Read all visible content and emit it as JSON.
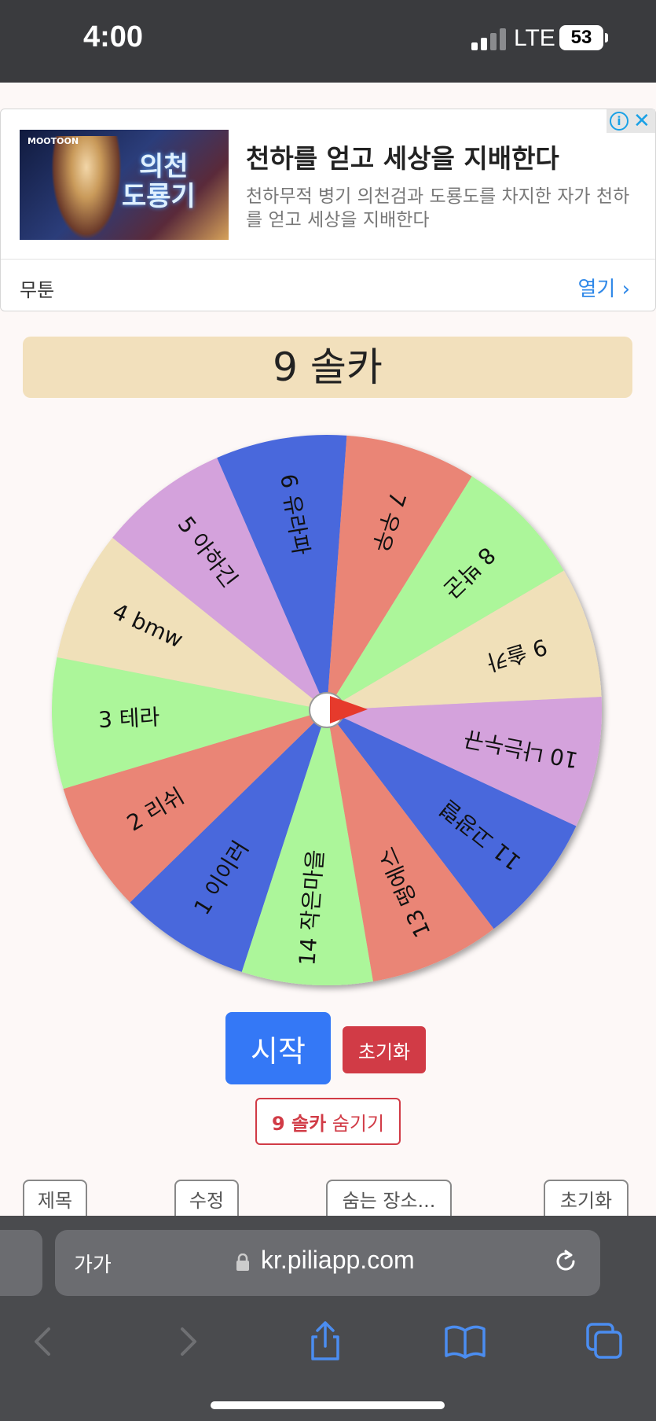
{
  "status_bar": {
    "time": "4:00",
    "network": "LTE",
    "battery": "53"
  },
  "ad": {
    "image_logo_text": "MOOTOON",
    "image_title_line1": "의천",
    "image_title_line2": "도룡기",
    "title": "천하를 얻고 세상을 지배한다",
    "description": "천하무적 병기 의천검과 도룡도를 차지한 자가 천하를 얻고 세상을 지배한다",
    "brand": "무툰",
    "open_label": "열기 ›"
  },
  "result": {
    "text": "9 솔카"
  },
  "wheel": {
    "segments": [
      {
        "label": "1 이이러",
        "color": "#4a67dc"
      },
      {
        "label": "2 리쉬",
        "color": "#ea8576"
      },
      {
        "label": "3 테라",
        "color": "#acf69a"
      },
      {
        "label": "4 bmw",
        "color": "#f0e0b9"
      },
      {
        "label": "5 아하긴",
        "color": "#d4a2dc"
      },
      {
        "label": "6 유라파",
        "color": "#4a67dc"
      },
      {
        "label": "7 우우",
        "color": "#ea8576"
      },
      {
        "label": "8 박군",
        "color": "#acf69a"
      },
      {
        "label": "9 솔카",
        "color": "#f0e0b9"
      },
      {
        "label": "10 나는누규",
        "color": "#d4a2dc"
      },
      {
        "label": "11 고광렬",
        "color": "#4a67dc"
      },
      {
        "label": "13 떵에스",
        "color": "#ea8576"
      },
      {
        "label": "14 작은마을",
        "color": "#acf69a"
      }
    ],
    "pointer_color": "#e63a2c"
  },
  "controls": {
    "start_label": "시작",
    "reset_label": "초기화",
    "hide_prefix": "9 솔카",
    "hide_suffix": " 숨기기"
  },
  "tabs": [
    "제목",
    "수정",
    "숨는 장소...",
    "초기화"
  ],
  "browser": {
    "aa_label": "가가",
    "url": "kr.piliapp.com"
  }
}
